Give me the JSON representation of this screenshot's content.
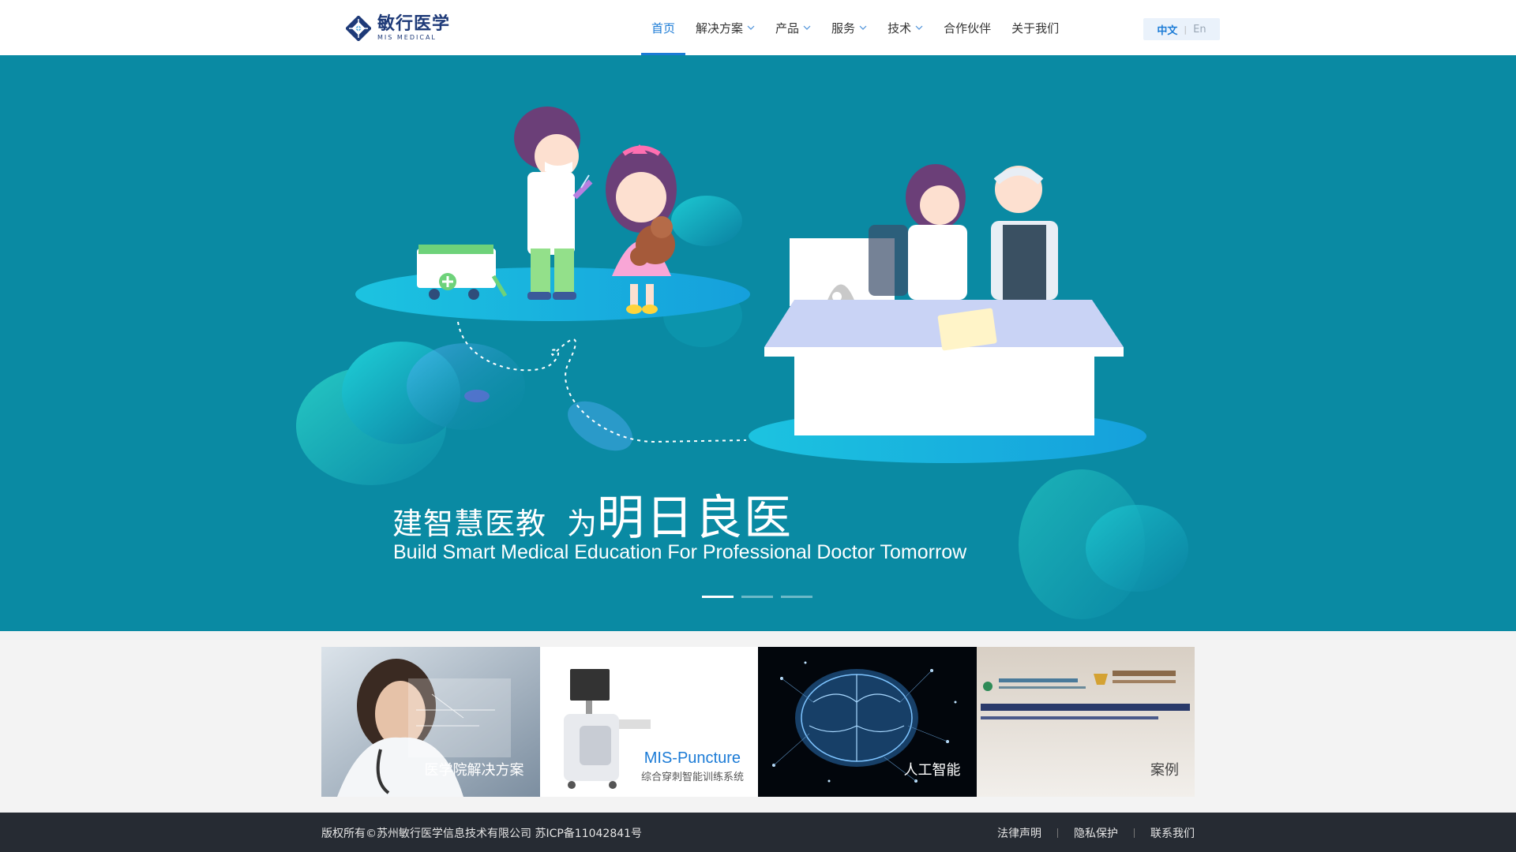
{
  "brand": {
    "name_cn": "敏行医学",
    "name_en": "MIS MEDICAL",
    "primary_color": "#1b7bd6",
    "hero_bg": "#0a8aa3",
    "footer_bg": "#262b33"
  },
  "nav": {
    "items": [
      {
        "label": "首页",
        "active": true,
        "dropdown": false
      },
      {
        "label": "解决方案",
        "active": false,
        "dropdown": true
      },
      {
        "label": "产品",
        "active": false,
        "dropdown": true
      },
      {
        "label": "服务",
        "active": false,
        "dropdown": true
      },
      {
        "label": "技术",
        "active": false,
        "dropdown": true
      },
      {
        "label": "合作伙伴",
        "active": false,
        "dropdown": false
      },
      {
        "label": "关于我们",
        "active": false,
        "dropdown": false
      }
    ],
    "lang_cn": "中文",
    "lang_sep": "|",
    "lang_en": "En"
  },
  "hero": {
    "title_part1": "建智慧医教",
    "title_part2": "为",
    "title_part3": "明日良医",
    "subtitle": "Build Smart Medical Education For Professional Doctor Tomorrow",
    "slides": 3,
    "active_slide": 1
  },
  "cards": [
    {
      "label": "医学院解决方案",
      "sub": ""
    },
    {
      "label": "MIS-Puncture",
      "sub": "综合穿刺智能训练系统"
    },
    {
      "label": "人工智能",
      "sub": ""
    },
    {
      "label": "案例",
      "sub": ""
    }
  ],
  "footer": {
    "copyright": "版权所有©苏州敏行医学信息技术有限公司  苏ICP备11042841号",
    "links": [
      "法律声明",
      "隐私保护",
      "联系我们"
    ]
  }
}
